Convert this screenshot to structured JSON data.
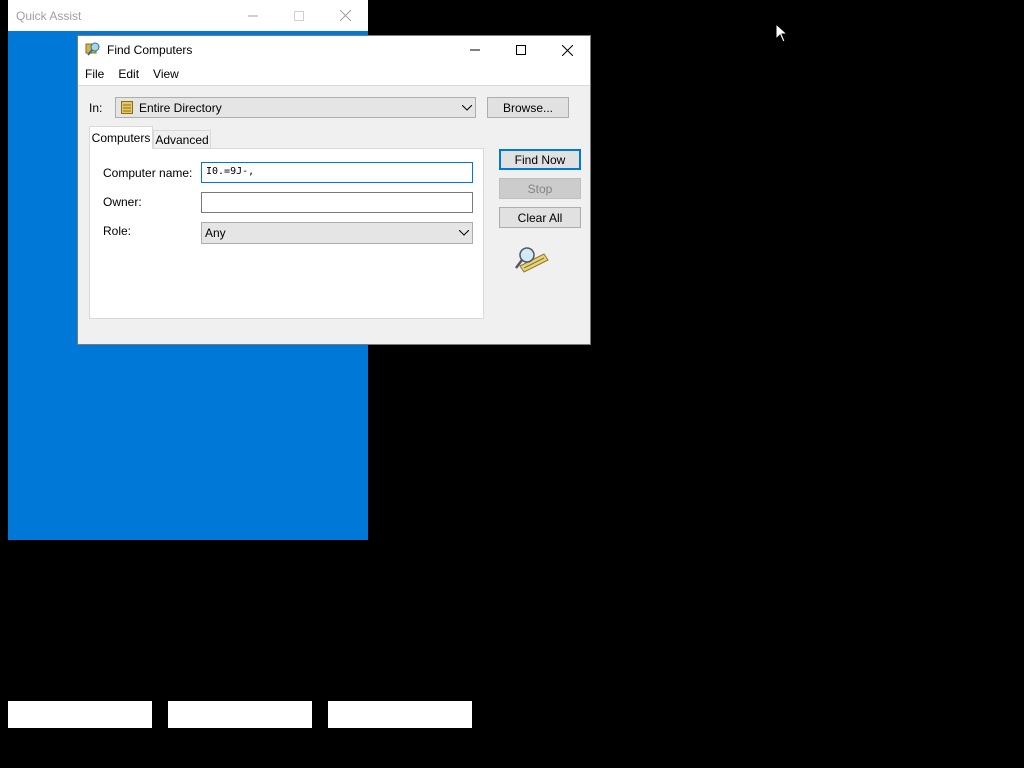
{
  "quick_assist": {
    "title": "Quick Assist",
    "accent_color": "#0078d7"
  },
  "dialog": {
    "title": "Find Computers",
    "menu": [
      "File",
      "Edit",
      "View"
    ],
    "in_label": "In:",
    "in_value": "Entire Directory",
    "browse_label": "Browse...",
    "tabs": [
      "Computers",
      "Advanced"
    ],
    "active_tab": "Computers",
    "fields": {
      "computer_name_label": "Computer name:",
      "computer_name_value": "I0.=9J-,",
      "owner_label": "Owner:",
      "owner_value": "",
      "role_label": "Role:",
      "role_value": "Any"
    },
    "buttons": {
      "find_now": "Find Now",
      "stop": "Stop",
      "clear_all": "Clear All"
    },
    "icons": [
      "directory-icon",
      "search-binoculars-icon",
      "minimize-icon",
      "maximize-icon",
      "close-icon"
    ]
  },
  "taskbar": {
    "items": [
      "",
      "",
      ""
    ]
  }
}
